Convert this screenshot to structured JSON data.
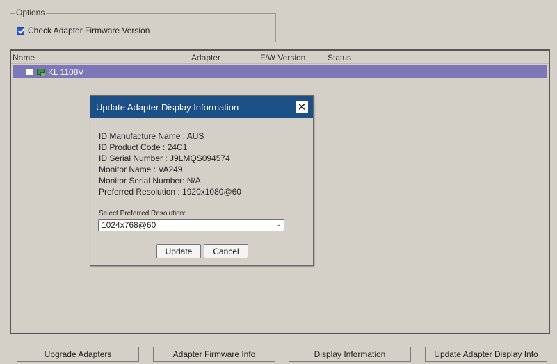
{
  "options": {
    "legend": "Options",
    "check_firmware_label": "Check Adapter Firmware Version",
    "check_firmware_checked": true
  },
  "list": {
    "columns": [
      "Name",
      "Adapter",
      "F/W Version",
      "Status"
    ],
    "rows": [
      {
        "expander": "–",
        "label": "KL 1108V"
      }
    ]
  },
  "dialog": {
    "title": "Update Adapter Display Information",
    "close_glyph": "✕",
    "info": [
      "ID Manufacture Name : AUS",
      "ID Product Code : 24C1",
      "ID Serial Number : J9LMQS094574",
      "Monitor Name : VA249",
      "Monitor Serial Number: N/A",
      "Preferred Resolution : 1920x1080@60"
    ],
    "select_label": "Select Preferred Resolution:",
    "select_value": "1024x768@60",
    "update_label": "Update",
    "cancel_label": "Cancel"
  },
  "bottom_buttons": {
    "upgrade": "Upgrade Adapters",
    "firmware_info": "Adapter Firmware Info",
    "display_info": "Display Information",
    "update_display_info": "Update Adapter Display Info"
  },
  "colors": {
    "titlebar": "#1c4f85",
    "selected_row": "#7c78b8",
    "background": "#d4d0c8"
  }
}
